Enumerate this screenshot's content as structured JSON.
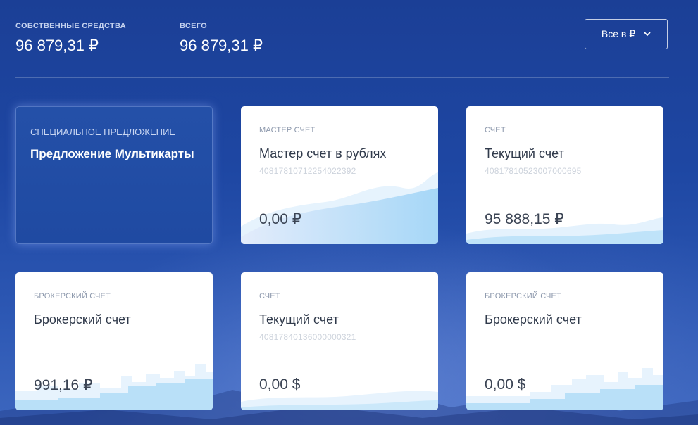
{
  "summary": {
    "own_funds_label": "СОБСТВЕННЫЕ СРЕДСТВА",
    "own_funds_value": "96 879,31 ₽",
    "total_label": "ВСЕГО",
    "total_value": "96 879,31 ₽"
  },
  "currency_select": {
    "label": "Все в ₽",
    "icon": "chevron-down-icon"
  },
  "cards": [
    {
      "kind": "promo",
      "type": "СПЕЦИАЛЬНОЕ ПРЕДЛОЖЕНИЕ",
      "name": "Предложение Мультикарты"
    },
    {
      "kind": "account",
      "type": "МАСТЕР СЧЕТ",
      "name": "Мастер счет в рублях",
      "number": "40817810712254022392",
      "amount": "0,00 ₽"
    },
    {
      "kind": "account",
      "type": "СЧЕТ",
      "name": "Текущий счет",
      "number": "40817810523007000695",
      "amount": "95 888,15 ₽"
    },
    {
      "kind": "account",
      "type": "БРОКЕРСКИЙ СЧЕТ",
      "name": "Брокерский счет",
      "number": "",
      "amount": "991,16 ₽"
    },
    {
      "kind": "account",
      "type": "СЧЕТ",
      "name": "Текущий счет",
      "number": "40817840136000000321",
      "amount": "0,00 $"
    },
    {
      "kind": "account",
      "type": "БРОКЕРСКИЙ СЧЕТ",
      "name": "Брокерский счет",
      "number": "",
      "amount": "0,00 $"
    }
  ],
  "colors": {
    "background": "#1e47a3",
    "card": "#ffffff",
    "wave": "#a9d8f7",
    "text_dark": "#303a4b"
  }
}
